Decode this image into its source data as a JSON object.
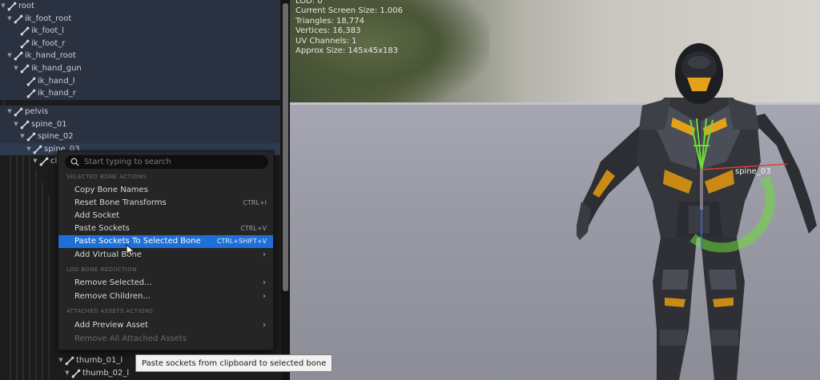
{
  "tree": {
    "rows": [
      {
        "label": "root"
      },
      {
        "label": "ik_foot_root"
      },
      {
        "label": "ik_foot_l"
      },
      {
        "label": "ik_foot_r"
      },
      {
        "label": "ik_hand_root"
      },
      {
        "label": "ik_hand_gun"
      },
      {
        "label": "ik_hand_l"
      },
      {
        "label": "ik_hand_r"
      },
      {
        "label": "pelvis"
      },
      {
        "label": "spine_01"
      },
      {
        "label": "spine_02"
      },
      {
        "label": "spine_03"
      },
      {
        "label": "cla"
      },
      {
        "label": "thumb_01_l"
      },
      {
        "label": "thumb_02_l"
      }
    ]
  },
  "viewport": {
    "stats": [
      "LOD: 0",
      "Current Screen Size: 1.006",
      "Triangles: 18,774",
      "Vertices: 16,383",
      "UV Channels: 1",
      "Approx Size: 145x45x183"
    ],
    "selected_bone_label": "spine_03"
  },
  "context_menu": {
    "search_placeholder": "Start typing to search",
    "sections": {
      "selected_bone_actions": "SELECTED BONE ACTIONS",
      "lod_bone_reduction": "LOD BONE REDUCTION",
      "attached_assets_actions": "ATTACHED ASSETS ACTIONS"
    },
    "items": {
      "copy_bone_names": "Copy Bone Names",
      "reset_bone_transforms": "Reset Bone Transforms",
      "reset_bone_transforms_shortcut": "CTRL+I",
      "add_socket": "Add Socket",
      "paste_sockets": "Paste Sockets",
      "paste_sockets_shortcut": "CTRL+V",
      "paste_sockets_to_selected_bone": "Paste Sockets To Selected Bone",
      "paste_sockets_to_selected_bone_shortcut": "CTRL+SHIFT+V",
      "add_virtual_bone": "Add Virtual Bone",
      "remove_selected": "Remove Selected...",
      "remove_children": "Remove Children...",
      "add_preview_asset": "Add Preview Asset",
      "remove_all_attached_assets": "Remove All Attached Assets"
    },
    "tooltip": "Paste sockets from clipboard to selected bone"
  },
  "colors": {
    "menu_highlight": "#1f6fd6",
    "bone_green": "#6fdc3a",
    "armor_accent": "#e3a21a"
  }
}
